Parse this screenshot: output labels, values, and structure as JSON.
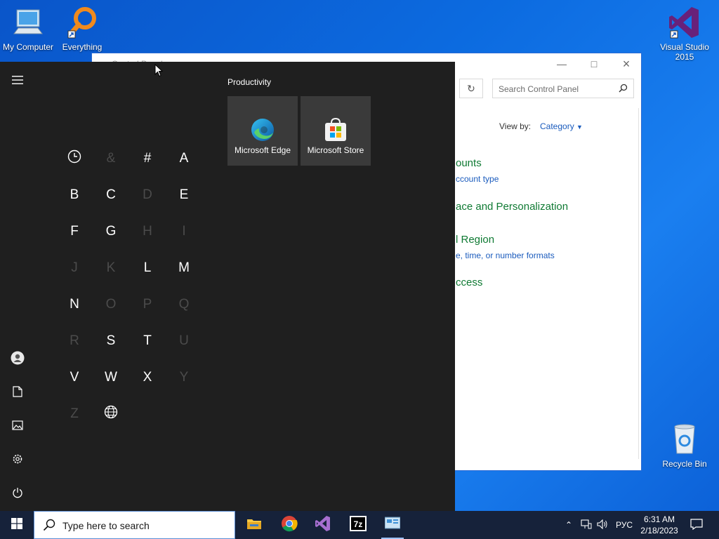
{
  "desktop": {
    "icons": [
      {
        "label": "My Computer",
        "icon": "computer-icon"
      },
      {
        "label": "Everything",
        "icon": "search-magnifier-icon"
      },
      {
        "label": "Visual Studio 2015",
        "icon": "visual-studio-icon"
      },
      {
        "label": "Recycle Bin",
        "icon": "recycle-bin-icon"
      }
    ]
  },
  "control_panel": {
    "title": "Control Panel",
    "search_placeholder": "Search Control Panel",
    "view_by_label": "View by:",
    "view_by_value": "Category",
    "categories": [
      {
        "title": "ounts",
        "sub": "ccount type"
      },
      {
        "title": "ace and Personalization",
        "sub": ""
      },
      {
        "title": "l Region",
        "sub": "e, time, or number formats"
      },
      {
        "title": "ccess",
        "sub": ""
      }
    ]
  },
  "start_menu": {
    "group_title": "Productivity",
    "tiles": [
      {
        "label": "Microsoft Edge",
        "icon": "edge-icon"
      },
      {
        "label": "Microsoft Store",
        "icon": "store-icon"
      }
    ],
    "letters": [
      {
        "char": "",
        "kind": "recent",
        "enabled": true
      },
      {
        "char": "&",
        "enabled": false
      },
      {
        "char": "#",
        "enabled": true
      },
      {
        "char": "A",
        "enabled": true
      },
      {
        "char": "B",
        "enabled": true
      },
      {
        "char": "C",
        "enabled": true
      },
      {
        "char": "D",
        "enabled": false
      },
      {
        "char": "E",
        "enabled": true
      },
      {
        "char": "F",
        "enabled": true
      },
      {
        "char": "G",
        "enabled": true
      },
      {
        "char": "H",
        "enabled": false
      },
      {
        "char": "I",
        "enabled": false
      },
      {
        "char": "J",
        "enabled": false
      },
      {
        "char": "K",
        "enabled": false
      },
      {
        "char": "L",
        "enabled": true
      },
      {
        "char": "M",
        "enabled": true
      },
      {
        "char": "N",
        "enabled": true
      },
      {
        "char": "O",
        "enabled": false
      },
      {
        "char": "P",
        "enabled": false
      },
      {
        "char": "Q",
        "enabled": false
      },
      {
        "char": "R",
        "enabled": false
      },
      {
        "char": "S",
        "enabled": true
      },
      {
        "char": "T",
        "enabled": true
      },
      {
        "char": "U",
        "enabled": false
      },
      {
        "char": "V",
        "enabled": true
      },
      {
        "char": "W",
        "enabled": true
      },
      {
        "char": "X",
        "enabled": true
      },
      {
        "char": "Y",
        "enabled": false
      },
      {
        "char": "Z",
        "enabled": false
      },
      {
        "char": "",
        "kind": "globe",
        "enabled": true
      }
    ]
  },
  "taskbar": {
    "search_placeholder": "Type here to search",
    "language": "РУС",
    "time": "6:31 AM",
    "date": "2/18/2023"
  }
}
